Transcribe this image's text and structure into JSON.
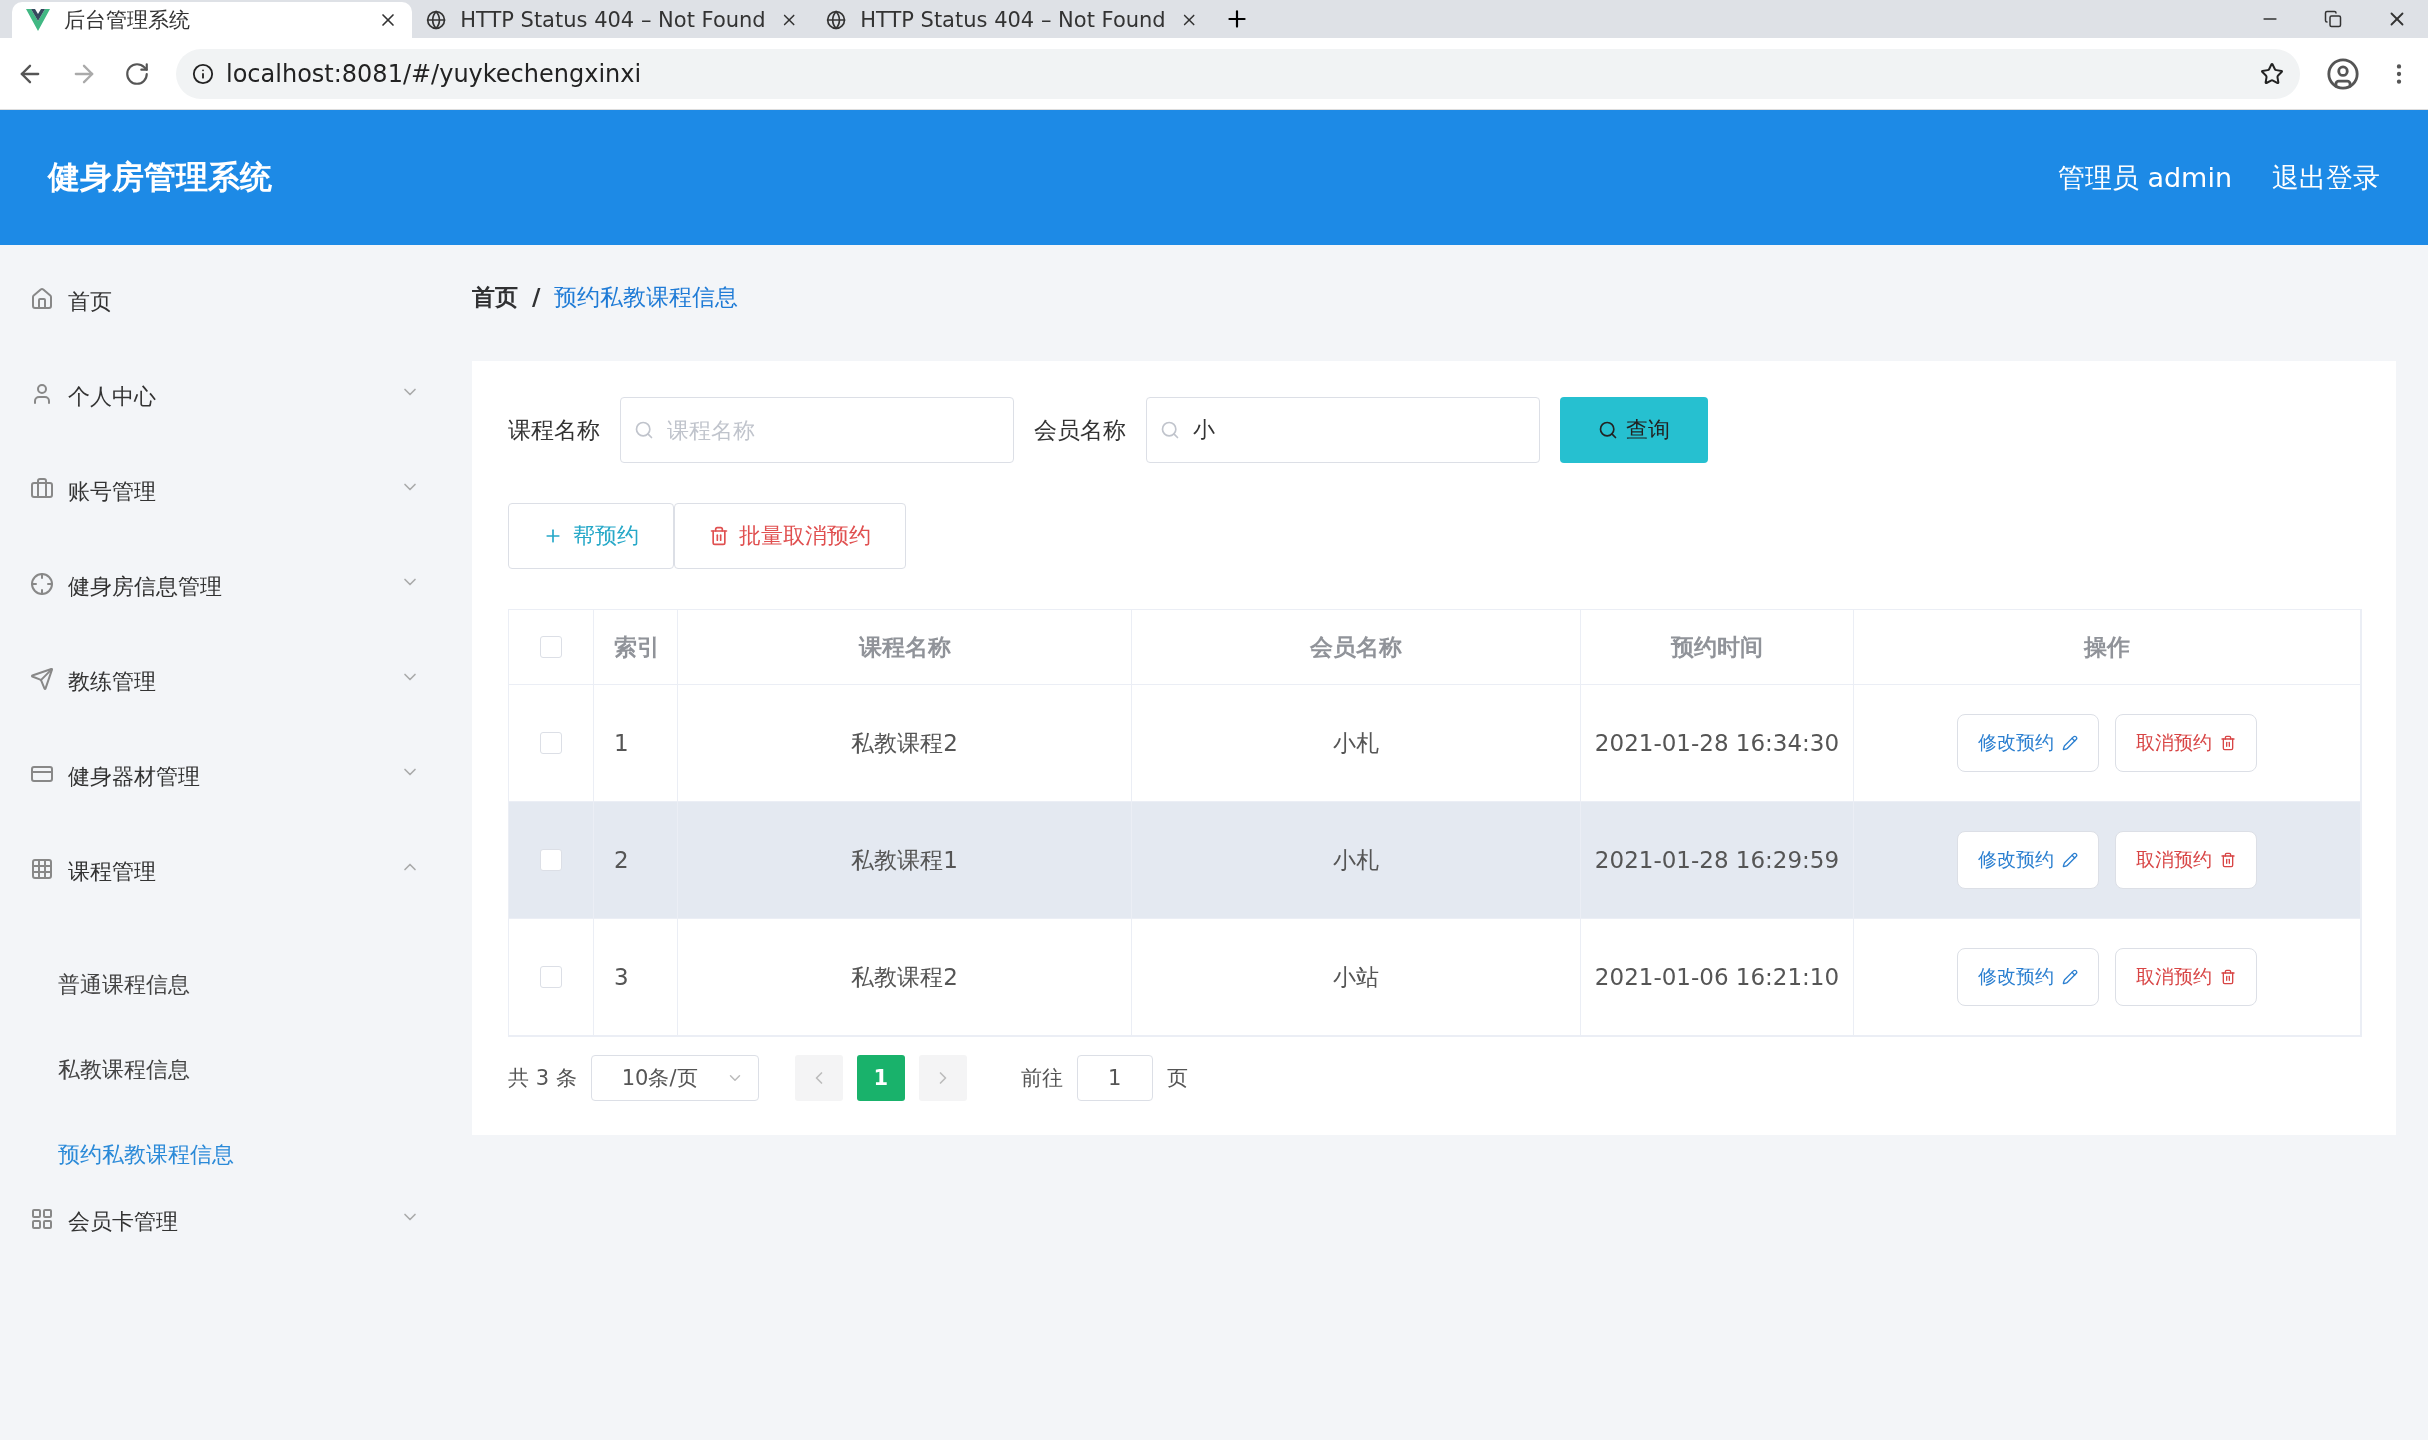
{
  "browser": {
    "tabs": [
      {
        "title": "后台管理系统",
        "selected": true
      },
      {
        "title": "HTTP Status 404 – Not Found",
        "selected": false
      },
      {
        "title": "HTTP Status 404 – Not Found",
        "selected": false
      }
    ],
    "address": "localhost:8081/#/yuykechengxinxi"
  },
  "header": {
    "title": "健身房管理系统",
    "user": "管理员 admin",
    "logout": "退出登录"
  },
  "sidebar": {
    "items": [
      {
        "label": "首页"
      },
      {
        "label": "个人中心",
        "expanded": false
      },
      {
        "label": "账号管理",
        "expanded": false
      },
      {
        "label": "健身房信息管理",
        "expanded": false
      },
      {
        "label": "教练管理",
        "expanded": false
      },
      {
        "label": "健身器材管理",
        "expanded": false
      },
      {
        "label": "课程管理",
        "expanded": true,
        "children": [
          {
            "label": "普通课程信息",
            "selected": false
          },
          {
            "label": "私教课程信息",
            "selected": false
          },
          {
            "label": "预约私教课程信息",
            "selected": true
          }
        ]
      },
      {
        "label": "会员卡管理",
        "expanded": false
      }
    ]
  },
  "breadcrumb": {
    "items": [
      "首页",
      "预约私教课程信息"
    ],
    "separator": "/"
  },
  "search": {
    "fields": [
      {
        "label": "课程名称",
        "placeholder": "课程名称"
      },
      {
        "label": "会员名称",
        "value": "小"
      }
    ],
    "button": "查询"
  },
  "actions": [
    {
      "label": "帮预约",
      "kind": "add"
    },
    {
      "label": "批量取消预约",
      "kind": "delete"
    }
  ],
  "table": {
    "all_checked": false,
    "columns": [
      "索引",
      "课程名称",
      "会员名称",
      "预约时间",
      "操作"
    ],
    "rows": [
      {
        "checked": false,
        "index": "1",
        "course": "私教课程2",
        "member": "小札",
        "time": "2021-01-28 16:34:30",
        "hovered": false,
        "edit": "修改预约",
        "cancel": "取消预约"
      },
      {
        "checked": false,
        "index": "2",
        "course": "私教课程1",
        "member": "小札",
        "time": "2021-01-28 16:29:59",
        "hovered": true,
        "edit": "修改预约",
        "cancel": "取消预约"
      },
      {
        "checked": false,
        "index": "3",
        "course": "私教课程2",
        "member": "小站",
        "time": "2021-01-06 16:21:10",
        "hovered": false,
        "edit": "修改预约",
        "cancel": "取消预约"
      }
    ]
  },
  "pagination": {
    "total": "共 3 条",
    "page_size": "10条/页",
    "pages": [
      {
        "label": "1",
        "selected": true
      }
    ],
    "goto_label": "前往",
    "goto_value": "1",
    "goto_suffix": "页"
  }
}
